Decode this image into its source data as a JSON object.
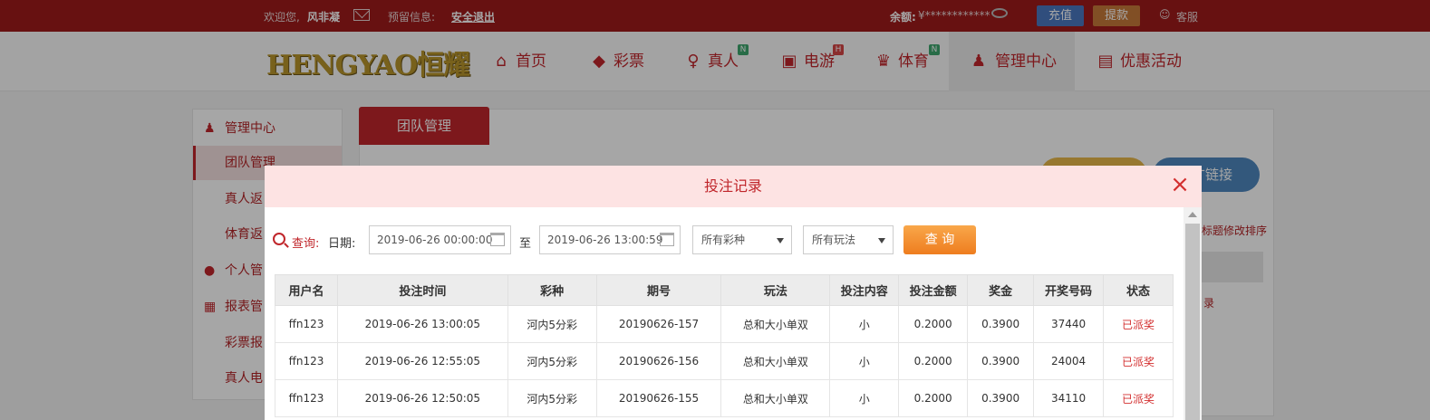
{
  "topbar": {
    "welcome": "欢迎您,",
    "username": "风非凝",
    "reserve_label": "预留信息:",
    "logout": "安全退出",
    "balance_label": "余额:",
    "balance_value": "¥************",
    "recharge": "充值",
    "withdraw": "提款",
    "service": "客服"
  },
  "logo": "HENGYAO恒耀",
  "nav": {
    "items": [
      {
        "label": "首页",
        "icon": "home-icon"
      },
      {
        "label": "彩票",
        "icon": "ticket-icon"
      },
      {
        "label": "真人",
        "icon": "dealer-icon",
        "badge": "N"
      },
      {
        "label": "电游",
        "icon": "slot-icon",
        "badge": "H"
      },
      {
        "label": "体育",
        "icon": "trophy-icon",
        "badge": "N"
      },
      {
        "label": "管理中心",
        "icon": "users-icon"
      },
      {
        "label": "优惠活动",
        "icon": "gift-icon"
      }
    ]
  },
  "sidebar": {
    "items": [
      {
        "label": "管理中心"
      },
      {
        "label": "团队管理"
      },
      {
        "label": "真人返"
      },
      {
        "label": "体育返"
      },
      {
        "label": "个人管"
      },
      {
        "label": "报表管"
      },
      {
        "label": "彩票报"
      },
      {
        "label": "真人电"
      }
    ]
  },
  "main": {
    "tab": "团队管理",
    "promo_link": "广链接",
    "hint": "标题修改排序",
    "record": "录"
  },
  "modal": {
    "title": "投注记录",
    "close": "×",
    "query_label": "查询:",
    "date_label": "日期:",
    "start_date": "2019-06-26 00:00:00",
    "to_label": "至",
    "end_date": "2019-06-26 13:00:59",
    "lottery_select": "所有彩种",
    "play_select": "所有玩法",
    "query_button": "查 询",
    "table": {
      "headers": [
        "用户名",
        "投注时间",
        "彩种",
        "期号",
        "玩法",
        "投注内容",
        "投注金额",
        "奖金",
        "开奖号码",
        "状态"
      ],
      "rows": [
        [
          "ffn123",
          "2019-06-26 13:00:05",
          "河内5分彩",
          "20190626-157",
          "总和大小单双",
          "小",
          "0.2000",
          "0.3900",
          "37440",
          "已派奖"
        ],
        [
          "ffn123",
          "2019-06-26 12:55:05",
          "河内5分彩",
          "20190626-156",
          "总和大小单双",
          "小",
          "0.2000",
          "0.3900",
          "24004",
          "已派奖"
        ],
        [
          "ffn123",
          "2019-06-26 12:50:05",
          "河内5分彩",
          "20190626-155",
          "总和大小单双",
          "小",
          "0.2000",
          "0.3900",
          "34110",
          "已派奖"
        ]
      ]
    }
  },
  "colors": {
    "brand_red": "#c0262b",
    "topbar": "#9e1b1b",
    "modal_header": "#fde3e3",
    "query_button": "#f39133"
  }
}
